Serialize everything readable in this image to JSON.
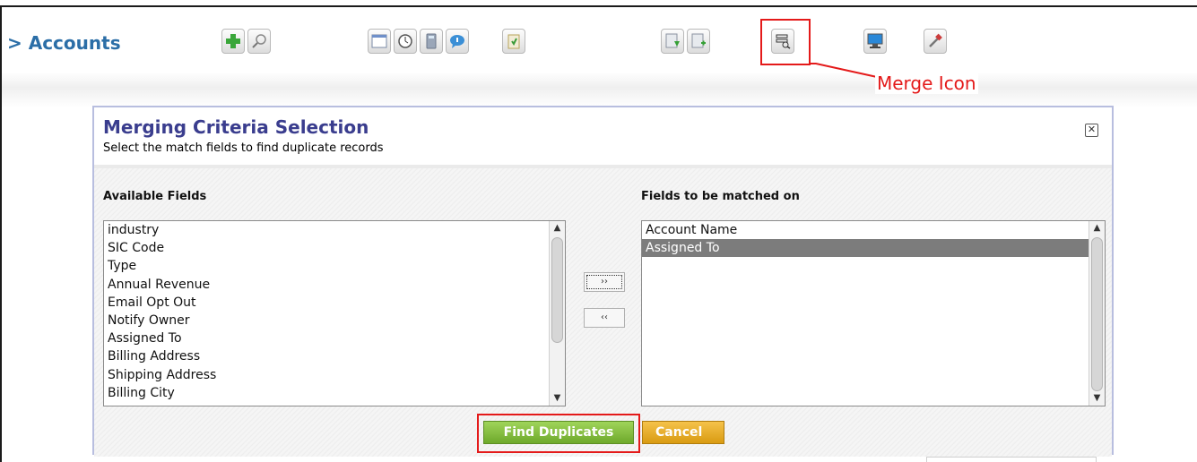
{
  "header": {
    "title": "> Accounts"
  },
  "toolbar": {
    "buttons": [
      {
        "icon": "add-icon"
      },
      {
        "icon": "search-icon"
      },
      {
        "icon": "calendar-icon"
      },
      {
        "icon": "clock-icon"
      },
      {
        "icon": "calculator-icon"
      },
      {
        "icon": "chat-icon"
      },
      {
        "icon": "clipboard-icon"
      },
      {
        "icon": "import-icon"
      },
      {
        "icon": "export-icon"
      },
      {
        "icon": "merge-icon"
      },
      {
        "icon": "monitor-icon"
      },
      {
        "icon": "tools-icon"
      }
    ]
  },
  "annotation": {
    "merge_label": "Merge Icon",
    "highlight_color": "#e41a1a"
  },
  "dialog": {
    "title": "Merging Criteria Selection",
    "subtitle": "Select the match fields to find duplicate records",
    "close_label": "✕",
    "available_label": "Available Fields",
    "matched_label": "Fields to be matched on",
    "available_fields": [
      "industry",
      "SIC Code",
      "Type",
      "Annual Revenue",
      "Email Opt Out",
      "Notify Owner",
      "Assigned To",
      "Billing Address",
      "Shipping Address",
      "Billing City"
    ],
    "matched_fields": [
      "Account Name",
      "Assigned To"
    ],
    "selected_matched": "Assigned To",
    "move_right_label": "››",
    "move_left_label": "‹‹",
    "find_label": "Find Duplicates",
    "cancel_label": "Cancel"
  },
  "colors": {
    "title_blue": "#2b6ea7",
    "dialog_title": "#3a3d8e",
    "find_green": "#7cb93a",
    "cancel_orange": "#e6a818"
  }
}
